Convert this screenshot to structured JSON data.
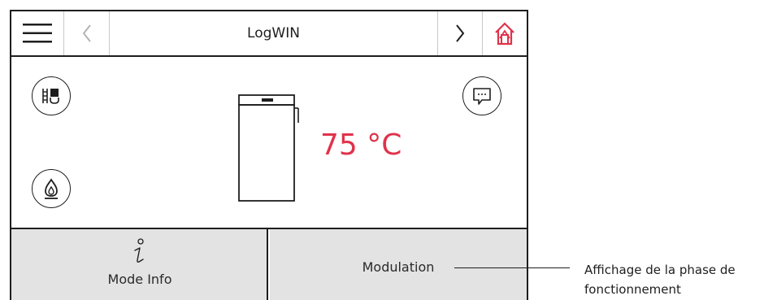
{
  "header": {
    "title": "LogWIN",
    "menu_icon": "hamburger-menu-icon",
    "back_icon": "chevron-left-icon",
    "next_icon": "chevron-right-icon",
    "home_icon": "home-icon"
  },
  "main": {
    "temperature": "75 °C",
    "left_buttons": [
      "dhw-icon",
      "flame-icon"
    ],
    "right_buttons": [
      "message-icon"
    ],
    "boiler_icon": "boiler-icon"
  },
  "bottom": {
    "left_label": "Mode Info",
    "left_icon": "info-icon",
    "right_label": "Modulation"
  },
  "annotation": {
    "text": "Affichage de la phase de fonctionnement"
  },
  "colors": {
    "accent": "#e0334b",
    "panel": "#e3e3e3",
    "line": "#1e1e1e"
  }
}
